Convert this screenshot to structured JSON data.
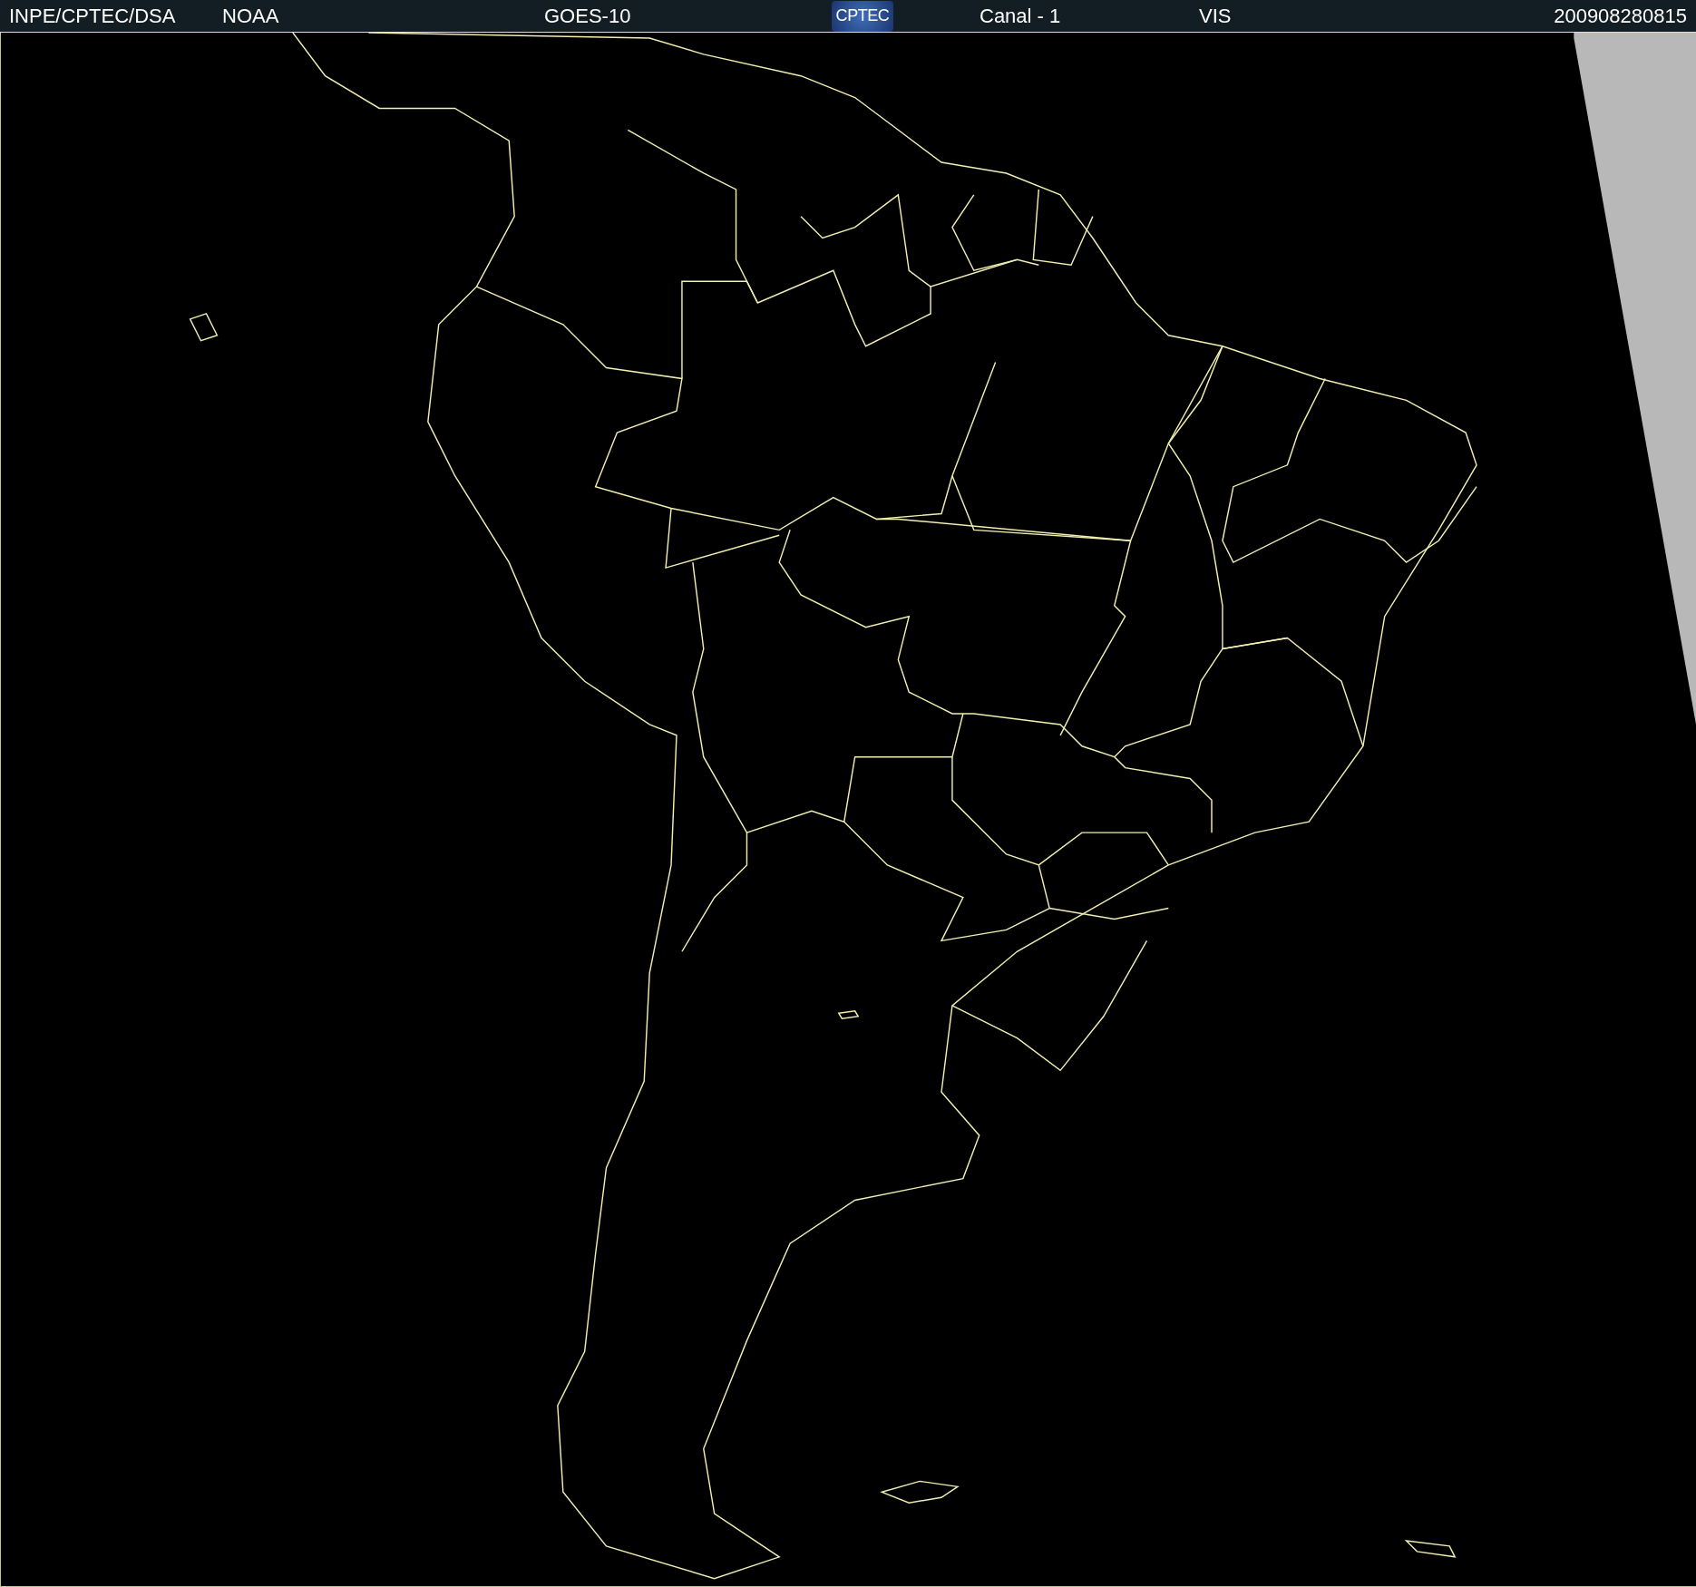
{
  "header": {
    "items": [
      {
        "kind": "text",
        "text": "INPE/CPTEC/DSA"
      },
      {
        "kind": "text",
        "text": "NOAA"
      },
      {
        "kind": "text",
        "text": "GOES-10"
      },
      {
        "kind": "logo",
        "text": "CPTEC"
      },
      {
        "kind": "text",
        "text": "Canal - 1"
      },
      {
        "kind": "text",
        "text": "VIS"
      },
      {
        "kind": "text",
        "text": "200908280815"
      }
    ]
  }
}
